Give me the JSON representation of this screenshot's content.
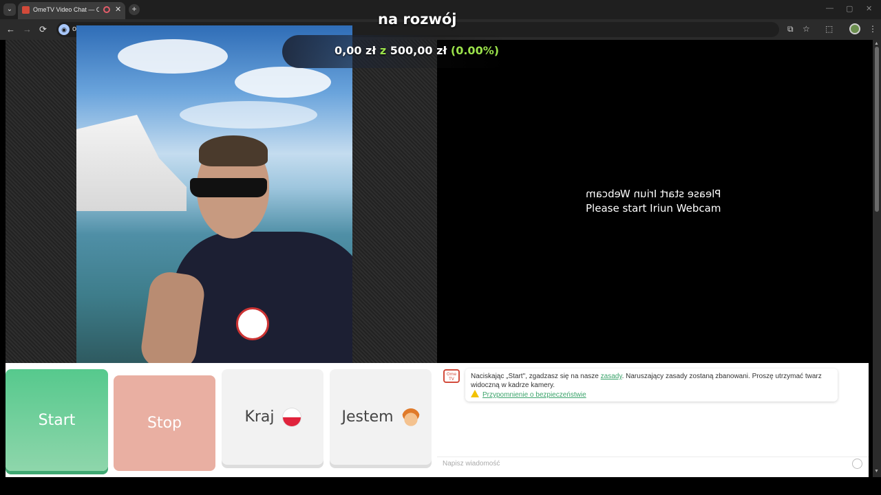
{
  "browser": {
    "tab_title": "OmeTV Video Chat — Ome",
    "tab_close": "✕",
    "new_tab": "+",
    "url_fragment": "o",
    "menu_glyph": "⌄",
    "site_icon_glyph": "◉",
    "window_controls": [
      "—",
      "▢",
      "✕"
    ]
  },
  "nav": {
    "back": "←",
    "forward": "→",
    "reload": "⟳"
  },
  "toolbar_icons": {
    "cast": "⧉",
    "star": "☆",
    "extensions": "⬚",
    "menu": "⋮"
  },
  "goal": {
    "title": "na rozwój",
    "current": "0,00 zł",
    "separator": "z",
    "target": "500,00 zł",
    "percent": "(0.00%)",
    "progress_fraction": 0.0
  },
  "remote": {
    "message_mirrored": "Please start Iriun Webcam",
    "message": "Please start Iriun Webcam"
  },
  "controls": {
    "start_label": "Start",
    "stop_label": "Stop",
    "country_label": "Kraj",
    "country_flag": "flag-pl-icon",
    "gender_label": "Jestem",
    "gender_avatar": "boy-emoji-icon"
  },
  "chat": {
    "logo_text": "Ome TV",
    "notice_prefix": "Naciskając „Start\", zgadzasz się na nasze ",
    "notice_link": "zasady",
    "notice_suffix": ". Naruszający zasady zostaną zbanowani. Proszę utrzymać twarz widoczną w kadrze kamery.",
    "safety_link": "Przypomnienie o bezpieczeństwie",
    "input_placeholder": "Napisz wiadomość"
  },
  "colors": {
    "start_button": "#56c98d",
    "stop_button": "#e9afa2",
    "goal_accent": "#9be24b",
    "link_green": "#3aa36a"
  }
}
